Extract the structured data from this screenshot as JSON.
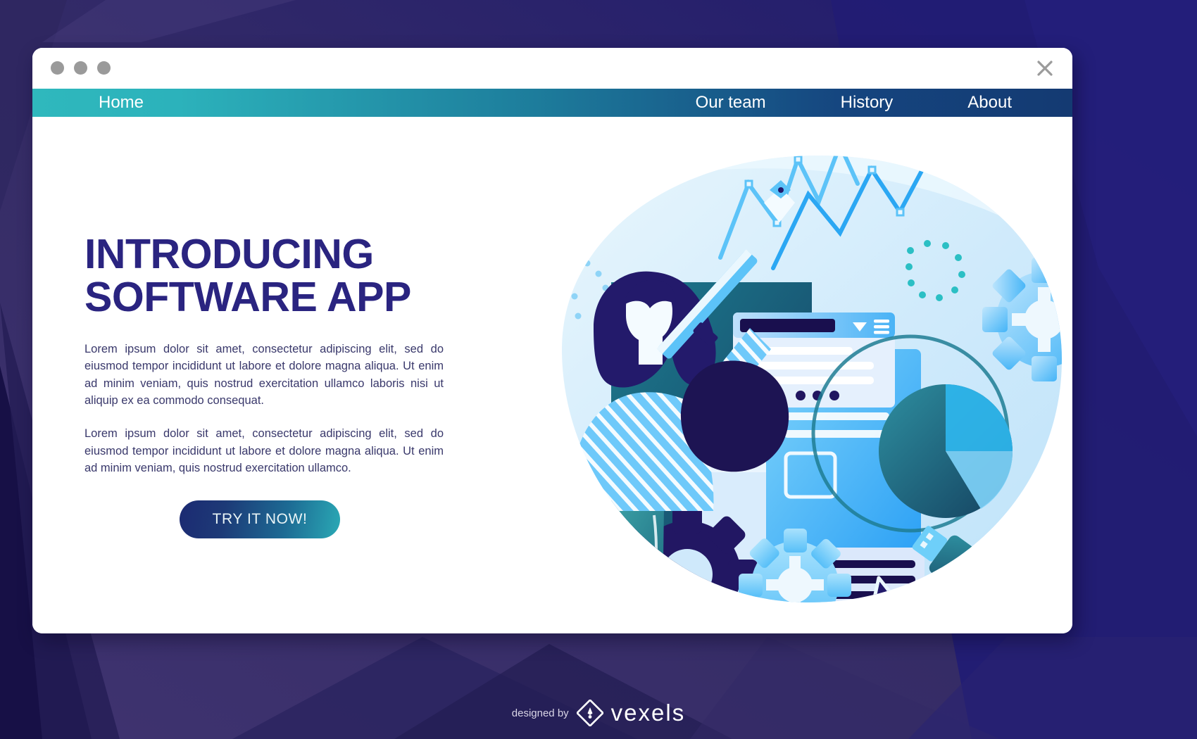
{
  "window": {
    "traffic_lights": [
      "red-dot",
      "yellow-dot",
      "green-dot"
    ],
    "close_label": "×"
  },
  "nav": {
    "home_label": "Home",
    "items": [
      {
        "label": "Our team"
      },
      {
        "label": "History"
      },
      {
        "label": "About"
      }
    ],
    "gradient_from": "#2fb8bd",
    "gradient_to": "#143a72"
  },
  "hero": {
    "headline_line1": "INTRODUCING",
    "headline_line2": "SOFTWARE APP",
    "headline_color": "#2a2480",
    "paragraph1": "Lorem ipsum dolor sit amet, consectetur adipiscing elit, sed do eiusmod tempor incididunt ut labore et dolore magna aliqua. Ut enim ad minim veniam, quis nostrud exercitation ullamco laboris nisi ut aliquip ex ea commodo consequat.",
    "paragraph2": "Lorem ipsum dolor sit amet, consectetur adipiscing elit, sed do eiusmod tempor incididunt ut labore et dolore magna aliqua. Ut enim ad minim veniam, quis nostrud exercitation ullamco.",
    "cta_label": "TRY IT NOW!",
    "cta_gradient_from": "#1c2a72",
    "cta_gradient_to": "#2aa9b5"
  },
  "illustration": {
    "description": "woman-with-pen-tool-and-software-icons",
    "elements": [
      "woman-figure",
      "pen-nib-tool",
      "line-chart",
      "dialog-window",
      "chat-bubble",
      "pie-chart",
      "gears",
      "usb-drive",
      "mouse-cursor"
    ]
  },
  "footer": {
    "designed_by": "designed by",
    "brand": "vexels"
  },
  "background": {
    "base_color": "#3b3169",
    "accent_color": "#1f1a70",
    "shadow_color": "#120d3d"
  }
}
